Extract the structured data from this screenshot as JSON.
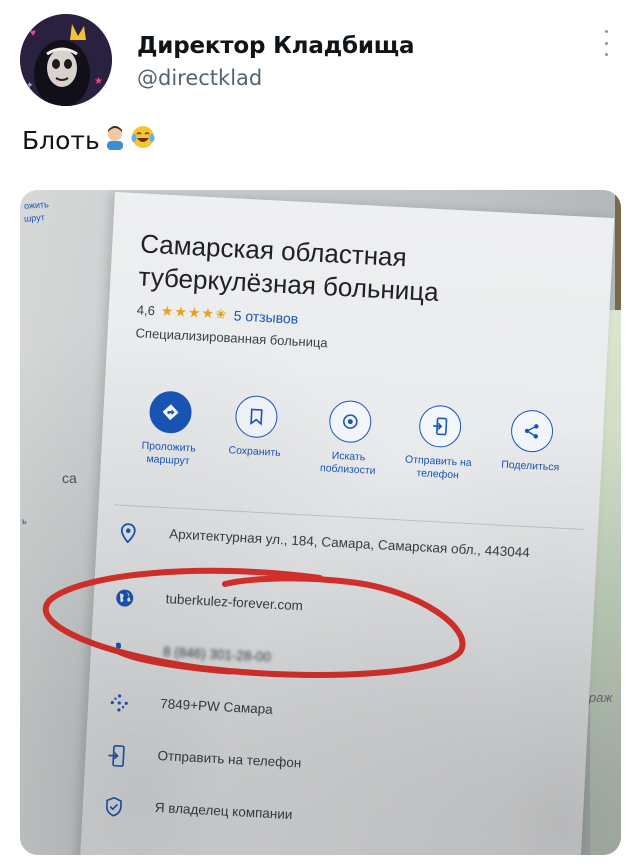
{
  "tweet": {
    "author_name": "Директор Кладбища",
    "author_handle": "@directklad",
    "text": "Блоть",
    "emojis": [
      "man-facepalming-emoji",
      "laughing-tears-emoji"
    ]
  },
  "photo": {
    "left_panel_fragments": [
      "ожить",
      "шрут"
    ],
    "left_side_fragments": [
      "са",
      "ь"
    ],
    "right_side_fragment": "Вираж",
    "place_card": {
      "title": "Самарская областная туберкулёзная больница",
      "rating": "4,6",
      "stars": 4.5,
      "reviews": "5 отзывов",
      "category": "Специализированная больница",
      "actions": [
        {
          "icon": "directions-icon",
          "label": "Проложить маршрут"
        },
        {
          "icon": "bookmark-icon",
          "label": "Сохранить"
        },
        {
          "icon": "nearby-search-icon",
          "label": "Искать поблизости"
        },
        {
          "icon": "send-to-phone-icon",
          "label": "Отправить на телефон"
        },
        {
          "icon": "share-icon",
          "label": "Поделиться"
        }
      ],
      "address": "Архитектурная ул., 184, Самара, Самарская обл., 443044",
      "website": "tuberkulez-forever.com",
      "phone": "8 (846) 301-28-00",
      "plus_code": "7849+PW Самара",
      "send_to_phone": "Отправить на телефон",
      "claim_business": "Я владелец компании"
    },
    "annotation_color": "#e0322c"
  },
  "colors": {
    "accent_blue": "#1a56b8",
    "star_gold": "#e7a11b",
    "handle_gray": "#536471"
  }
}
